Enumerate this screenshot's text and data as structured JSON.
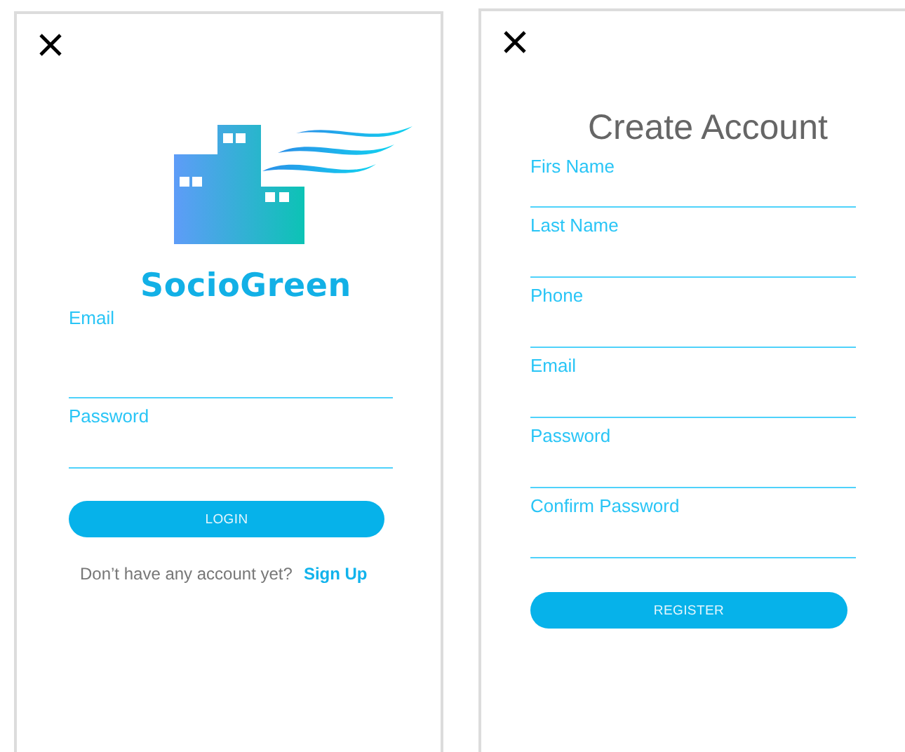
{
  "screens": [
    {
      "kind": "login",
      "brand": "SocioGreen",
      "fields": [
        {
          "placeholder": "Email"
        },
        {
          "placeholder": "Password"
        }
      ],
      "button": "LOGIN",
      "prompt": "Don’t have any account yet?",
      "link": "Sign Up"
    },
    {
      "kind": "register",
      "title": "Create Account",
      "fields": [
        {
          "placeholder": "Firs Name"
        },
        {
          "placeholder": "Last Name"
        },
        {
          "placeholder": "Phone"
        },
        {
          "placeholder": "Email"
        },
        {
          "placeholder": "Password"
        },
        {
          "placeholder": "Confirm Password"
        }
      ],
      "button": "REGISTER"
    }
  ]
}
